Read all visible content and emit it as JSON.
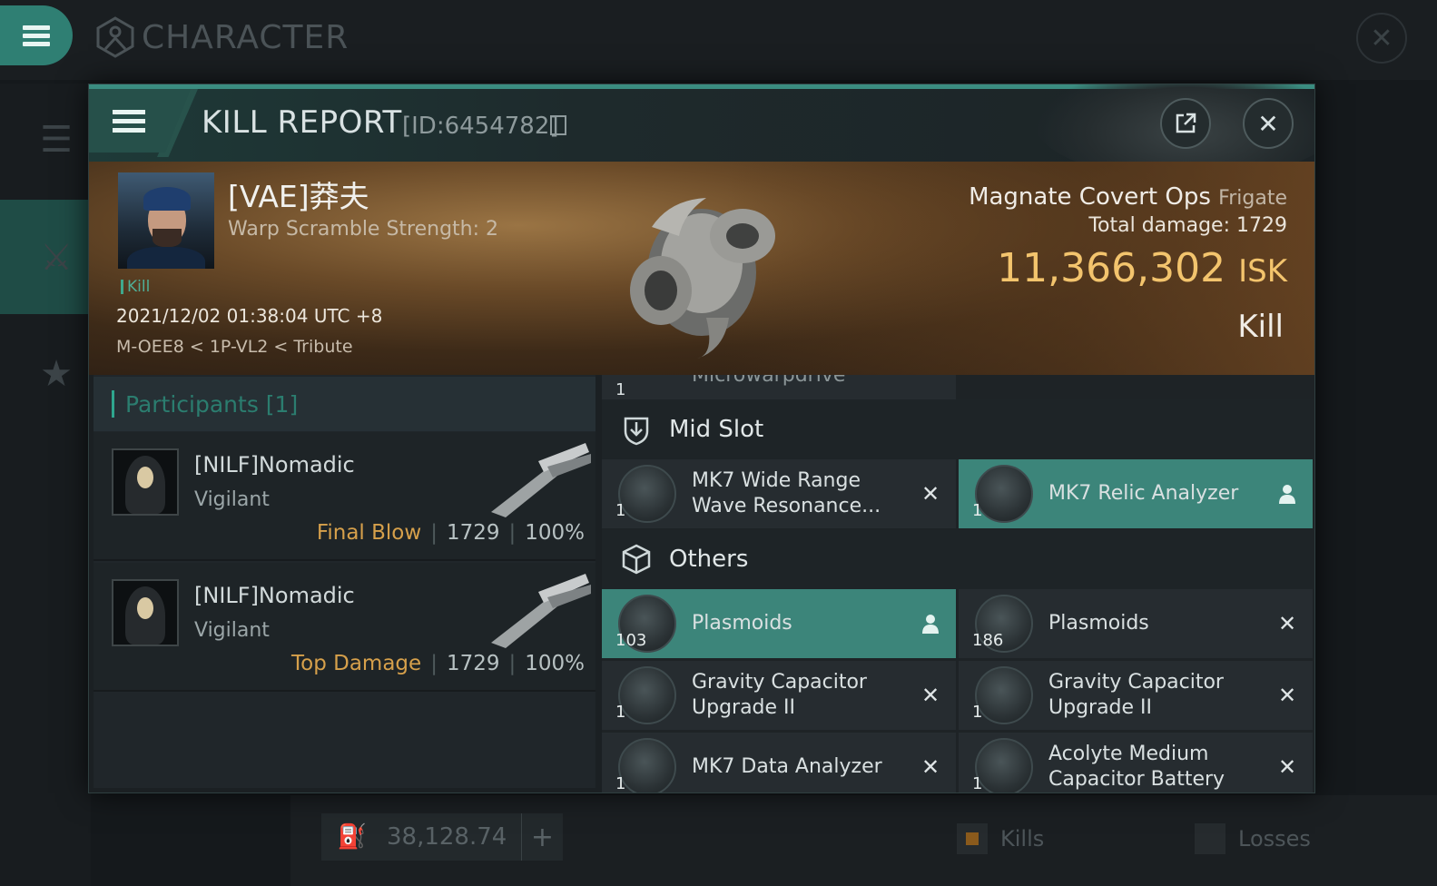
{
  "app": {
    "title": "CHARACTER",
    "wallet": {
      "value": "38,128.74",
      "add_label": "+"
    },
    "tabs": {
      "kills": "Kills",
      "losses": "Losses"
    }
  },
  "report": {
    "title": "KILL REPORT",
    "id_label": "[ID:6454782]",
    "victim": {
      "name": "[VAE]莽夫",
      "subtitle": "Warp Scramble Strength: 2",
      "tag": "Kill",
      "datetime": "2021/12/02 01:38:04 UTC +8",
      "location": "M-OEE8 < 1P-VL2 < Tribute"
    },
    "ship": {
      "name": "Magnate Covert Ops",
      "class": "Frigate",
      "total_damage_label": "Total damage:",
      "total_damage": "1729",
      "isk_value": "11,366,302",
      "isk_unit": "ISK",
      "result": "Kill"
    },
    "participants": {
      "header": "Participants [1]",
      "list": [
        {
          "name": "[NILF]Nomadic",
          "ship": "Vigilant",
          "tag": "Final Blow",
          "damage": "1729",
          "percent": "100%"
        },
        {
          "name": "[NILF]Nomadic",
          "ship": "Vigilant",
          "tag": "Top Damage",
          "damage": "1729",
          "percent": "100%"
        }
      ]
    },
    "items": {
      "cut_item": {
        "qty": "1",
        "name": "Microwarpdrive"
      },
      "mid_slot": {
        "title": "Mid Slot",
        "items": [
          {
            "qty": "1",
            "name": "MK7 Wide Range Wave Resonance...",
            "state": "destroyed"
          },
          {
            "qty": "1",
            "name": "MK7 Relic Analyzer",
            "state": "dropped"
          }
        ]
      },
      "others": {
        "title": "Others",
        "items": [
          {
            "qty": "103",
            "name": "Plasmoids",
            "state": "dropped"
          },
          {
            "qty": "186",
            "name": "Plasmoids",
            "state": "destroyed"
          },
          {
            "qty": "1",
            "name": "Gravity Capacitor Upgrade II",
            "state": "destroyed"
          },
          {
            "qty": "1",
            "name": "Gravity Capacitor Upgrade II",
            "state": "destroyed"
          },
          {
            "qty": "1",
            "name": "MK7 Data Analyzer",
            "state": "destroyed"
          },
          {
            "qty": "1",
            "name": "Acolyte Medium Capacitor Battery",
            "state": "destroyed"
          }
        ]
      }
    }
  },
  "icons": {
    "menu": "hamburger-icon",
    "character": "character-emblem-icon",
    "close": "close-icon",
    "share": "external-link-icon",
    "copy": "copy-icon",
    "mid_slot": "mid-slot-icon",
    "others": "cargo-box-icon",
    "destroyed": "x-icon",
    "dropped": "person-icon"
  },
  "colors": {
    "accent": "#3c857a",
    "isk": "#f3c46d",
    "tag": "#d6a04b"
  }
}
